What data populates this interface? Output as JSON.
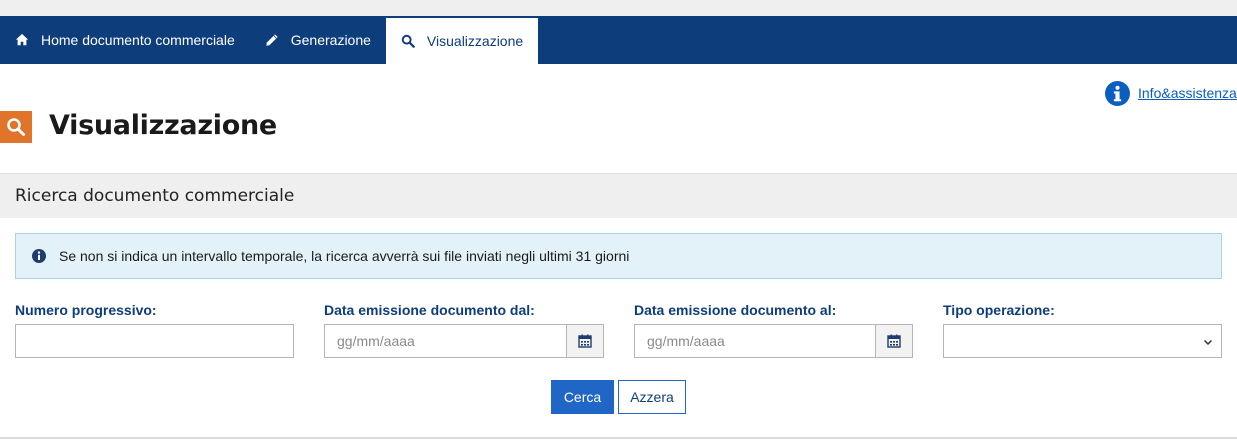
{
  "nav": {
    "items": [
      {
        "label": "Home documento commerciale",
        "icon": "home-icon"
      },
      {
        "label": "Generazione",
        "icon": "pencil-icon"
      },
      {
        "label": "Visualizzazione",
        "icon": "search-icon",
        "active": true
      }
    ]
  },
  "header": {
    "info_link": "Info&assistenza",
    "title": "Visualizzazione",
    "title_icon": "search-icon"
  },
  "section": {
    "title": "Ricerca documento commerciale"
  },
  "alert": {
    "text": "Se non si indica un intervallo temporale, la ricerca avverrà sui file inviati negli ultimi 31 giorni",
    "icon": "info-icon"
  },
  "form": {
    "numero_label": "Numero progressivo:",
    "numero_value": "",
    "dal_label": "Data emissione documento dal:",
    "dal_placeholder": "gg/mm/aaaa",
    "al_label": "Data emissione documento al:",
    "al_placeholder": "gg/mm/aaaa",
    "tipo_label": "Tipo operazione:",
    "tipo_value": ""
  },
  "buttons": {
    "search": "Cerca",
    "reset": "Azzera"
  },
  "colors": {
    "navbar": "#0e3d7c",
    "accent_orange": "#e0742a",
    "primary_button": "#1f66c7",
    "alert_bg": "#e3f1f8"
  }
}
